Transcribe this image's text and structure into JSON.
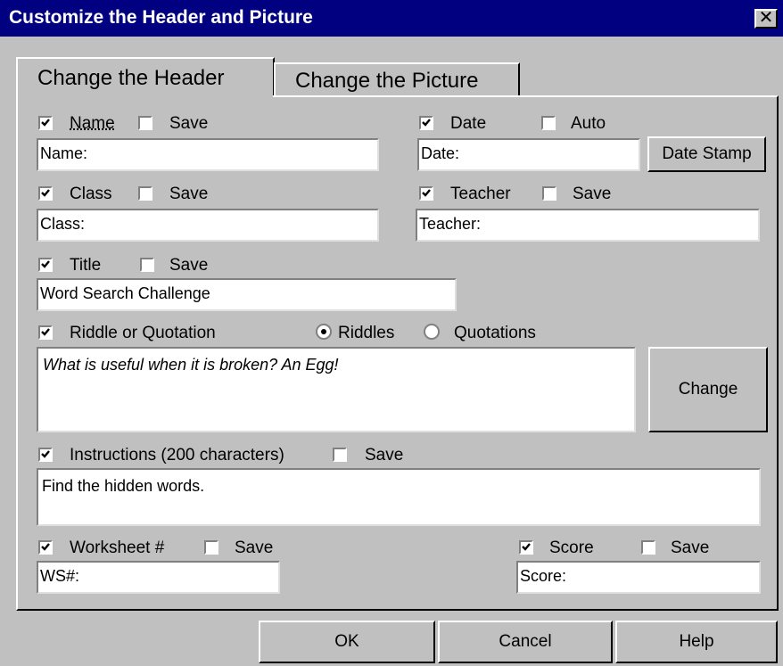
{
  "window": {
    "title": "Customize the Header and Picture",
    "close_glyph": "✕"
  },
  "tabs": [
    {
      "label": "Change the Header",
      "active": true
    },
    {
      "label": "Change the Picture",
      "active": false
    }
  ],
  "name": {
    "label": "Name",
    "checked": true,
    "save_label": "Save",
    "save_checked": false,
    "value": "Name:"
  },
  "date": {
    "label": "Date",
    "checked": true,
    "auto_label": "Auto",
    "auto_checked": false,
    "value": "Date:",
    "stamp_label": "Date Stamp"
  },
  "class": {
    "label": "Class",
    "checked": true,
    "save_label": "Save",
    "save_checked": false,
    "value": "Class:"
  },
  "teacher": {
    "label": "Teacher",
    "checked": true,
    "save_label": "Save",
    "save_checked": false,
    "value": "Teacher:"
  },
  "title": {
    "label": "Title",
    "checked": true,
    "save_label": "Save",
    "save_checked": false,
    "value": "Word Search Challenge"
  },
  "riddle": {
    "label": "Riddle or Quotation",
    "checked": true,
    "riddles_label": "Riddles",
    "quotations_label": "Quotations",
    "selected": "Riddles",
    "value": "What is useful when it is broken? An Egg!",
    "change_label": "Change"
  },
  "instructions": {
    "label": "Instructions (200 characters)",
    "checked": true,
    "save_label": "Save",
    "save_checked": false,
    "value": "Find the hidden words."
  },
  "worksheet": {
    "label": "Worksheet #",
    "checked": true,
    "save_label": "Save",
    "save_checked": false,
    "value": "WS#:"
  },
  "score": {
    "label": "Score",
    "checked": true,
    "save_label": "Save",
    "save_checked": false,
    "value": "Score:"
  },
  "footer": {
    "ok_label": "OK",
    "cancel_label": "Cancel",
    "help_label": "Help"
  },
  "icons": {
    "check": "check-icon",
    "close": "close-icon"
  }
}
